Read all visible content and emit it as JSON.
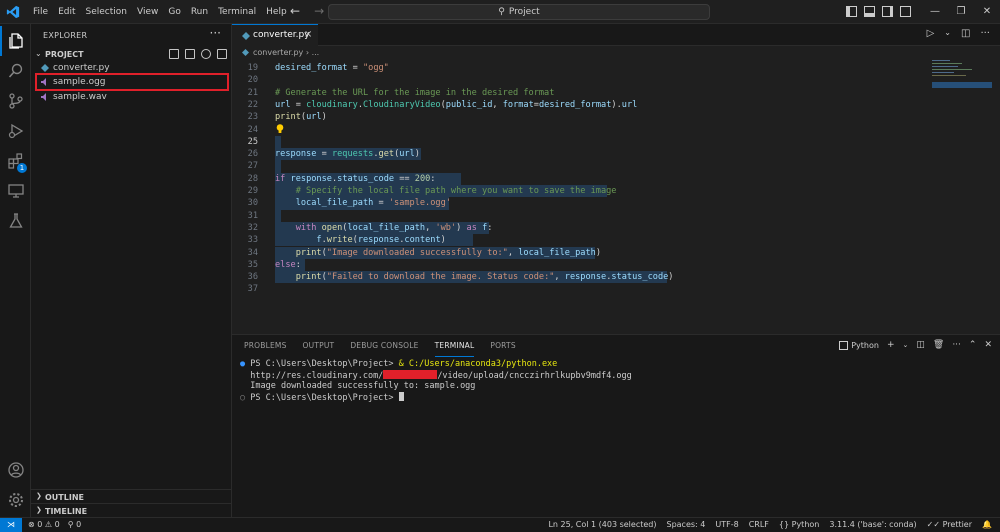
{
  "titlebar": {
    "menu": [
      "File",
      "Edit",
      "Selection",
      "View",
      "Go",
      "Run",
      "Terminal",
      "Help"
    ],
    "search": "Project",
    "accent": "#0078d4"
  },
  "activitybar": {
    "items": [
      "explorer-icon",
      "search-icon",
      "source-control-icon",
      "run-debug-icon",
      "extensions-icon",
      "remote-explorer-icon",
      "testing-icon"
    ],
    "extensions_badge": "1",
    "bottom": [
      "account-icon",
      "settings-gear-icon"
    ]
  },
  "sidebar": {
    "title": "EXPLORER",
    "project": "PROJECT",
    "files": [
      {
        "name": "converter.py",
        "type": "python"
      },
      {
        "name": "sample.ogg",
        "type": "audio"
      },
      {
        "name": "sample.wav",
        "type": "audio"
      }
    ],
    "outline": "OUTLINE",
    "timeline": "TIMELINE",
    "highlight_color": "#e0202a"
  },
  "editor": {
    "tab": "converter.py",
    "breadcrumb": "converter.py",
    "breadcrumb_more": "...",
    "line_numbers": [
      "19",
      "20",
      "21",
      "22",
      "23",
      "24",
      "25",
      "26",
      "27",
      "28",
      "29",
      "30",
      "31",
      "32",
      "33",
      "34",
      "35",
      "36",
      "37"
    ],
    "current_line": "25"
  },
  "panel": {
    "tabs": [
      "PROBLEMS",
      "OUTPUT",
      "DEBUG CONSOLE",
      "TERMINAL",
      "PORTS"
    ],
    "active_tab": "TERMINAL",
    "terminal_name": "Python",
    "lines": {
      "l1_prompt": "PS C:\\Users\\Desktop\\Project> ",
      "l1_cmd": "& C:/Users/anaconda3/python.exe",
      "l2_prefix": "http://res.cloudinary.com/",
      "l2_suffix": "/video/upload/cncczirhrlkupbv9mdf4.ogg",
      "l3": "Image downloaded successfully to: sample.ogg",
      "l4_prompt": "PS C:\\Users\\Desktop\\Project> "
    }
  },
  "statusbar": {
    "errors": "0",
    "warnings": "0",
    "ports": "0",
    "position": "Ln 25, Col 1 (403 selected)",
    "spaces": "Spaces: 4",
    "encoding": "UTF-8",
    "eol": "CRLF",
    "language": "Python",
    "interpreter": "3.11.4 ('base': conda)",
    "formatter": "Prettier"
  }
}
